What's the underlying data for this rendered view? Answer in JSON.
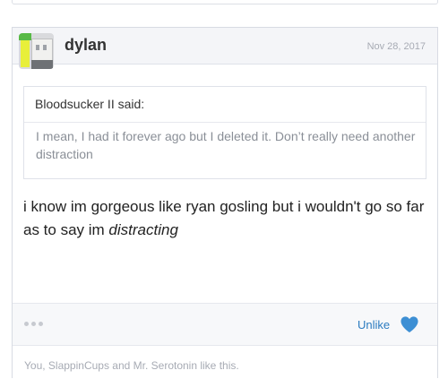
{
  "post": {
    "username": "dylan",
    "date": "Nov 28, 2017",
    "quote": {
      "author": "Bloodsucker II said:",
      "text": "I mean, I had it forever ago but I deleted it. Don’t really need another distraction"
    },
    "message": {
      "text": "i know im gorgeous like ryan gosling but i wouldn't go so far as to say im ",
      "emphasis": "distracting"
    },
    "actions": {
      "unlike_label": "Unlike",
      "heart_color": "#3d8fd4"
    },
    "likes_summary": "You, SlappinCups and Mr. Serotonin like this."
  }
}
